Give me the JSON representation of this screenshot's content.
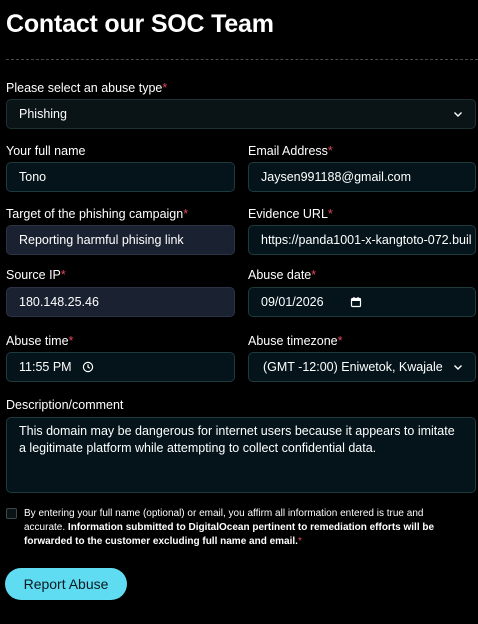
{
  "page": {
    "title": "Contact our SOC Team"
  },
  "form": {
    "abuse_type": {
      "label": "Please select an abuse type",
      "required_mark": "*",
      "value": "Phishing"
    },
    "full_name": {
      "label": "Your full name",
      "value": "Tono"
    },
    "email": {
      "label": "Email Address",
      "required_mark": "*",
      "value": "Jaysen991188@gmail.com"
    },
    "target": {
      "label": "Target of the phishing campaign",
      "required_mark": "*",
      "value": "Reporting harmful phising link"
    },
    "evidence_url": {
      "label": "Evidence URL",
      "required_mark": "*",
      "value": "https://panda1001-x-kangtoto-072.buil"
    },
    "source_ip": {
      "label": "Source IP",
      "required_mark": "*",
      "value": "180.148.25.46"
    },
    "abuse_date": {
      "label": "Abuse date",
      "required_mark": "*",
      "value": "09/01/2026"
    },
    "abuse_time": {
      "label": "Abuse time",
      "required_mark": "*",
      "value": "11:55 PM"
    },
    "abuse_timezone": {
      "label": "Abuse timezone",
      "required_mark": "*",
      "value": "(GMT -12:00) Eniwetok, Kwajale"
    },
    "description": {
      "label": "Description/comment",
      "value": "This domain may be dangerous for internet users because it appears to imitate a legitimate platform while attempting to collect confidential data."
    },
    "consent": {
      "text_plain": "By entering your full name (optional) or email, you affirm all information entered is true and accurate. ",
      "text_bold": "Information submitted to DigitalOcean pertinent to remediation efforts will be forwarded to the customer excluding full name and email.",
      "required_mark": "*",
      "checked": false
    },
    "submit_label": "Report Abuse"
  },
  "colors": {
    "background": "#000000",
    "accent_button": "#5fdcf2",
    "required": "#e0465a",
    "field_border": "#1d3a3d"
  },
  "icons": {
    "select_chevron": "chevron-down-icon",
    "date_picker": "calendar-icon",
    "time_picker": "clock-icon"
  }
}
